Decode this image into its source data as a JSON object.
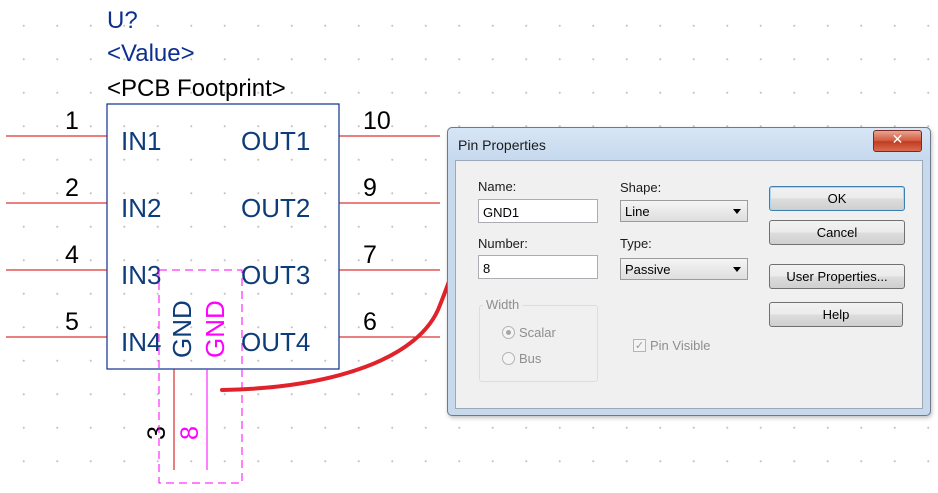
{
  "schematic": {
    "refdes": "U?",
    "value": "<Value>",
    "footprint": "<PCB Footprint>",
    "left_pins": [
      {
        "number": "1",
        "name": "IN1"
      },
      {
        "number": "2",
        "name": "IN2"
      },
      {
        "number": "4",
        "name": "IN3"
      },
      {
        "number": "5",
        "name": "IN4"
      }
    ],
    "right_pins": [
      {
        "number": "10",
        "name": "OUT1"
      },
      {
        "number": "9",
        "name": "OUT2"
      },
      {
        "number": "7",
        "name": "OUT3"
      },
      {
        "number": "6",
        "name": "OUT4"
      }
    ],
    "bottom_pins": [
      {
        "number": "3",
        "name": "GND"
      },
      {
        "number": "8",
        "name": "GND"
      }
    ],
    "colors": {
      "wire": "#d10000",
      "body": "#0d2f8f",
      "selected": "#ff00ff",
      "arrow": "#e0232b"
    }
  },
  "dialog": {
    "title": "Pin Properties",
    "close_label": "✕",
    "name_label": "Name:",
    "name_value": "GND1",
    "number_label": "Number:",
    "number_value": "8",
    "shape_label": "Shape:",
    "shape_value": "Line",
    "type_label": "Type:",
    "type_value": "Passive",
    "width_label": "Width",
    "scalar_label": "Scalar",
    "bus_label": "Bus",
    "pin_visible_label": "Pin Visible",
    "ok_label": "OK",
    "cancel_label": "Cancel",
    "user_properties_label": "User Properties...",
    "help_label": "Help"
  }
}
